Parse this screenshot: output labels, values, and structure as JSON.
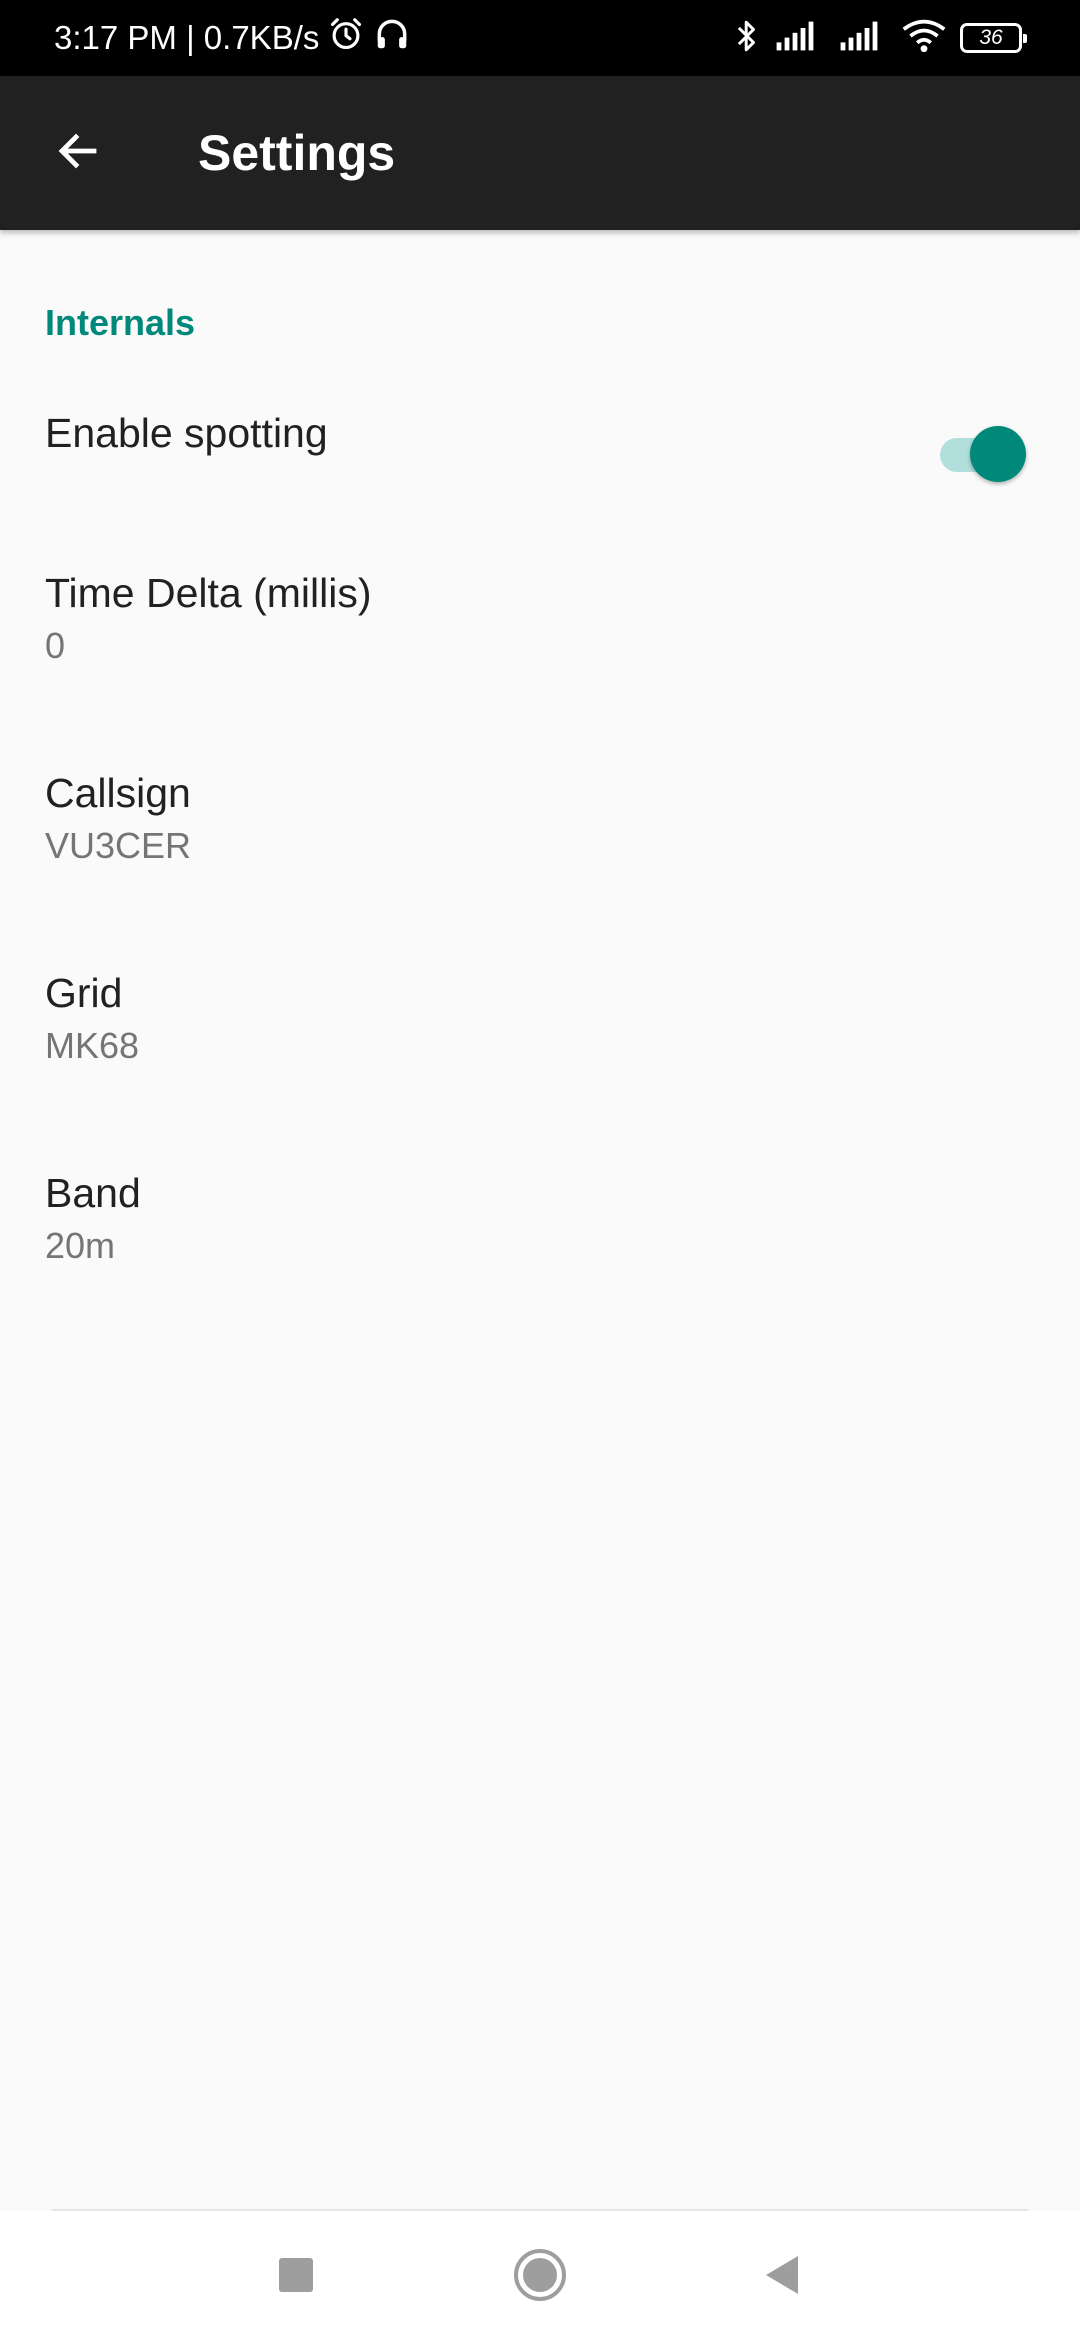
{
  "status_bar": {
    "time_and_speed": "3:17 PM | 0.7KB/s",
    "battery_level": "36",
    "icons": [
      "alarm-icon",
      "headset-icon",
      "bluetooth-icon",
      "signal-icon",
      "signal-icon",
      "wifi-icon",
      "battery-icon"
    ]
  },
  "app_bar": {
    "title": "Settings",
    "back_icon": "arrow-back-icon"
  },
  "section": {
    "header": "Internals"
  },
  "preferences": {
    "enable_spotting": {
      "title": "Enable spotting",
      "checked": true
    },
    "time_delta": {
      "title": "Time Delta (millis)",
      "summary": "0"
    },
    "callsign": {
      "title": "Callsign",
      "summary": "VU3CER"
    },
    "grid": {
      "title": "Grid",
      "summary": "MK68"
    },
    "band": {
      "title": "Band",
      "summary": "20m"
    }
  },
  "nav_bar": {
    "icons": [
      "recents-square-icon",
      "home-circle-icon",
      "back-triangle-icon"
    ]
  },
  "colors": {
    "accent": "#00897b",
    "app_bar": "#212121",
    "background": "#fafafa"
  }
}
